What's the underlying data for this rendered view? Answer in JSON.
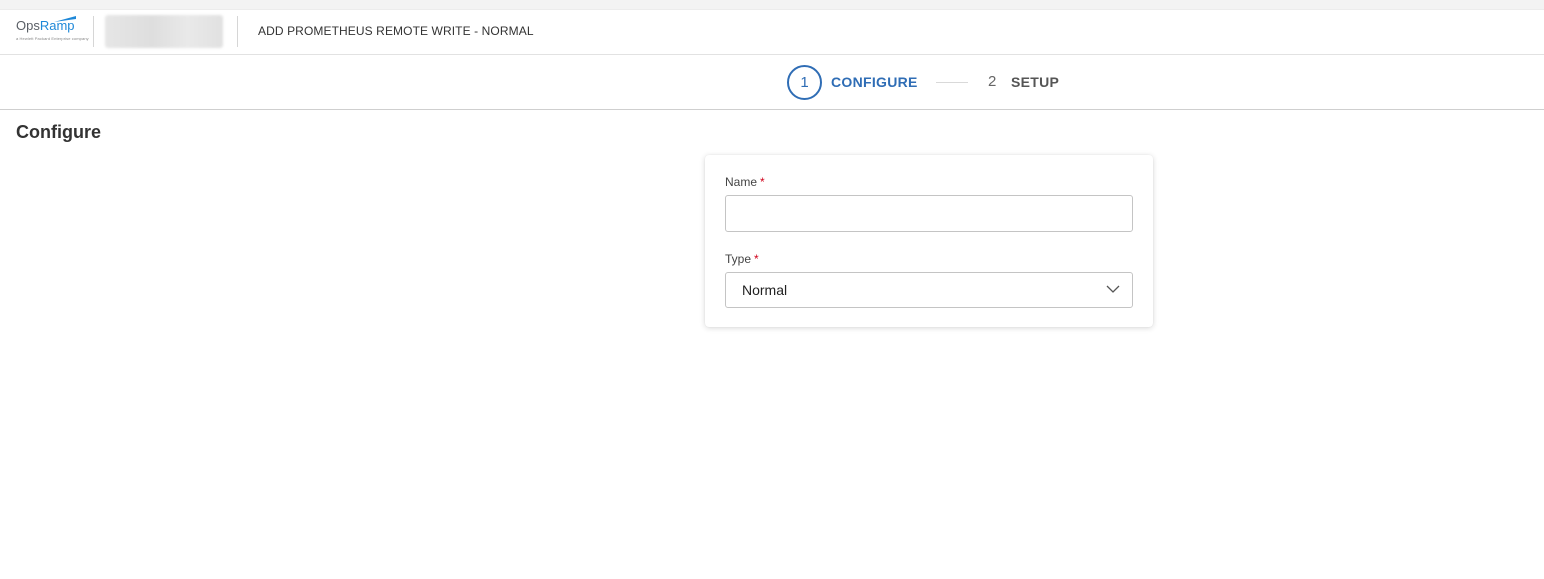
{
  "header": {
    "logo": {
      "prefix": "Ops",
      "brand": "Ramp",
      "tagline": "a Hewlett Packard Enterprise company"
    },
    "page_title": "ADD PROMETHEUS REMOTE WRITE - NORMAL"
  },
  "stepper": {
    "steps": [
      {
        "number": "1",
        "label": "CONFIGURE",
        "active": true
      },
      {
        "number": "2",
        "label": "SETUP",
        "active": false
      }
    ]
  },
  "section": {
    "title": "Configure"
  },
  "form": {
    "name": {
      "label": "Name",
      "required_mark": "*",
      "value": "",
      "placeholder": ""
    },
    "type": {
      "label": "Type",
      "required_mark": "*",
      "selected": "Normal"
    }
  },
  "colors": {
    "accent": "#2f6db5",
    "required": "#d0021b",
    "brand": "#1e88d8"
  }
}
